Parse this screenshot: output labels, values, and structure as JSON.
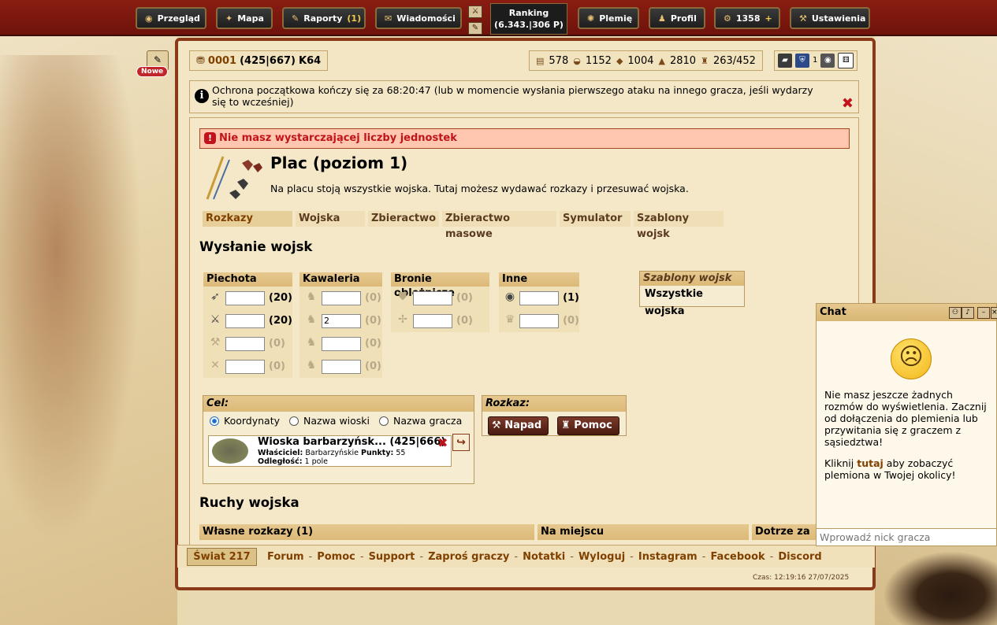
{
  "nav": {
    "przeglad": "Przegląd",
    "mapa": "Mapa",
    "raporty": "Raporty",
    "raporty_count": "(1)",
    "wiadomosci": "Wiadomości",
    "ranking_label": "Ranking",
    "ranking_value": "(6.343.|306 P)",
    "plemie": "Plemię",
    "profil": "Profil",
    "premium": "1358",
    "ustawienia": "Ustawienia"
  },
  "side": {
    "nowe": "Nowe"
  },
  "village": {
    "id": "0001",
    "coords": "(425|667)",
    "continent": "K64"
  },
  "resources": {
    "wood": "578",
    "clay": "1152",
    "iron": "1004",
    "storage": "2810",
    "population": "263/452"
  },
  "topicons": {
    "count": "1"
  },
  "notice": {
    "text": "Ochrona początkowa kończy się za 68:20:47 (lub w momencie wysłania pierwszego ataku na innego gracza, jeśli wydarzy się to wcześniej)"
  },
  "error": {
    "text": "Nie masz wystarczającej liczby jednostek"
  },
  "building": {
    "title": "Plac (poziom 1)",
    "desc": "Na placu stoją wszystkie wojska. Tutaj możesz wydawać rozkazy i przesuwać wojska."
  },
  "tabs": [
    "Rozkazy",
    "Wojska",
    "Zbieractwo",
    "Zbieractwo masowe",
    "Symulator",
    "Szablony wojsk"
  ],
  "send": {
    "title": "Wysłanie wojsk"
  },
  "units": {
    "infantry": {
      "header": "Piechota",
      "rows": [
        {
          "icon": "spear-icon",
          "count": "(20)",
          "value": ""
        },
        {
          "icon": "sword-icon",
          "count": "(20)",
          "value": ""
        },
        {
          "icon": "axe-icon",
          "count": "(0)",
          "value": ""
        },
        {
          "icon": "archer-icon",
          "count": "(0)",
          "value": ""
        }
      ]
    },
    "cavalry": {
      "header": "Kawaleria",
      "rows": [
        {
          "icon": "scout-icon",
          "count": "(0)",
          "value": ""
        },
        {
          "icon": "light-cavalry-icon",
          "count": "(0)",
          "value": "2"
        },
        {
          "icon": "mounted-archer-icon",
          "count": "(0)",
          "value": ""
        },
        {
          "icon": "heavy-cavalry-icon",
          "count": "(0)",
          "value": ""
        }
      ]
    },
    "siege": {
      "header": "Bronie oblężnicze",
      "rows": [
        {
          "icon": "ram-icon",
          "count": "(0)",
          "value": ""
        },
        {
          "icon": "catapult-icon",
          "count": "(0)",
          "value": ""
        }
      ]
    },
    "other": {
      "header": "Inne",
      "rows": [
        {
          "icon": "knight-icon",
          "count": "(1)",
          "value": ""
        },
        {
          "icon": "nobleman-icon",
          "count": "(0)",
          "value": ""
        }
      ]
    }
  },
  "templates": {
    "header": "Szablony wojsk",
    "item": "Wszystkie wojska"
  },
  "target": {
    "header": "Cel:",
    "opt1": "Koordynaty",
    "opt2": "Nazwa wioski",
    "opt3": "Nazwa gracza",
    "village_name": "Wioska barbarzyńsk... (425|666)",
    "owner_label": "Właściciel:",
    "owner": "Barbarzyńskie",
    "points_label": "Punkty:",
    "points": "55",
    "distance_label": "Odległość:",
    "distance": "1 pole"
  },
  "order": {
    "header": "Rozkaz:",
    "attack": "Napad",
    "support": "Pomoc"
  },
  "moves": {
    "title": "Ruchy wojska",
    "col1": "Własne rozkazy (1)",
    "col2": "Na miejscu",
    "col3": "Dotrze za"
  },
  "footer": {
    "world": "Świat 217",
    "links": [
      "Forum",
      "Pomoc",
      "Support",
      "Zaproś graczy",
      "Notatki",
      "Wyloguj",
      "Instagram",
      "Facebook",
      "Discord"
    ],
    "sep": "-",
    "time": "Czas: 12:19:16 27/07/2025"
  },
  "chat": {
    "title": "Chat",
    "msg": "Nie masz jeszcze żadnych rozmów do wyświetlenia. Zacznij od dołączenia do plemienia lub przywitania się z graczem z sąsiedztwa!",
    "msg2_pre": "Kliknij ",
    "msg2_link": "tutaj",
    "msg2_post": " aby zobaczyć plemiona w Twojej okolicy!",
    "placeholder": "Wprowadź nick gracza"
  }
}
